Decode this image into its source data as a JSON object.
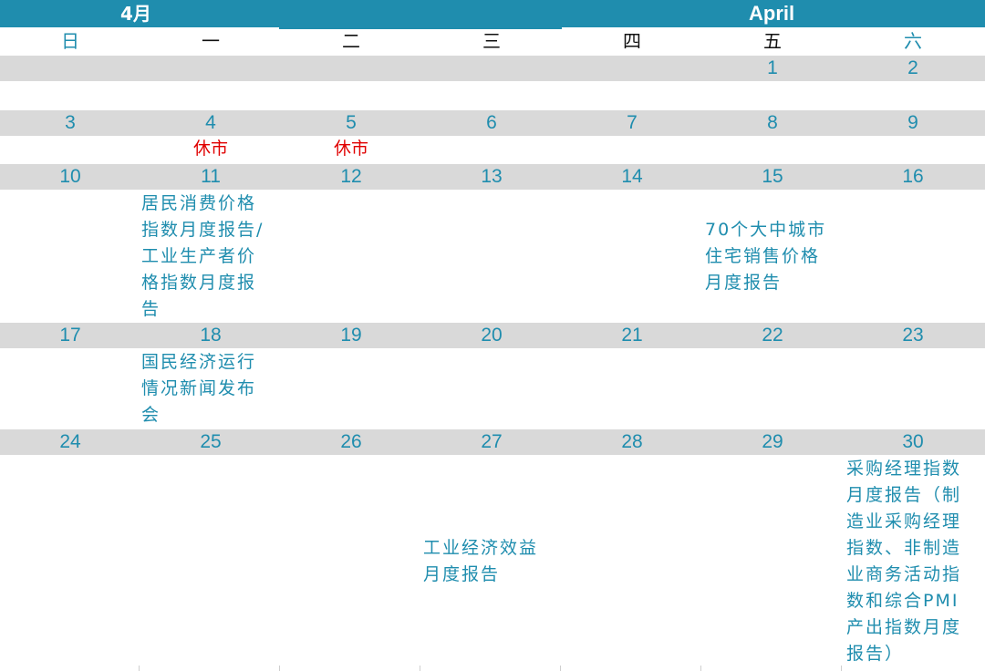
{
  "header": {
    "month_cn": "4月",
    "month_en": "April"
  },
  "weekdays": [
    "日",
    "一",
    "二",
    "三",
    "四",
    "五",
    "六"
  ],
  "weeks": [
    {
      "days": [
        "",
        "",
        "",
        "",
        "",
        "1",
        "2"
      ]
    },
    {
      "days": [
        "3",
        "4",
        "5",
        "6",
        "7",
        "8",
        "9"
      ]
    },
    {
      "days": [
        "10",
        "11",
        "12",
        "13",
        "14",
        "15",
        "16"
      ]
    },
    {
      "days": [
        "17",
        "18",
        "19",
        "20",
        "21",
        "22",
        "23"
      ]
    },
    {
      "days": [
        "24",
        "25",
        "26",
        "27",
        "28",
        "29",
        "30"
      ]
    }
  ],
  "holidays": {
    "apr4": "休市",
    "apr5": "休市"
  },
  "events": {
    "apr11": "居民消费价格\n指数月度报告/\n工业生产者价\n格指数月度报\n告",
    "apr15": "70个大中城市\n住宅销售价格\n月度报告",
    "apr18": "国民经济运行\n情况新闻发布\n会",
    "apr27": "工业经济效益\n月度报告",
    "apr30": "采购经理指数\n月度报告（制\n造业采购经理\n指数、非制造\n业商务活动指\n数和综合PMI\n产出指数月度\n报告）"
  },
  "colors": {
    "accent": "#1f8dae",
    "band": "#d9d9d9",
    "holiday": "#e00000"
  }
}
